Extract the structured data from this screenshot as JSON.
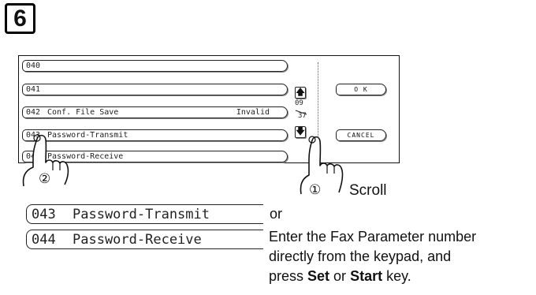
{
  "step": {
    "number": "6"
  },
  "lcd": {
    "rows": [
      {
        "num": "040",
        "name": "",
        "value": ""
      },
      {
        "num": "041",
        "name": "",
        "value": ""
      },
      {
        "num": "042",
        "name": "Conf. File Save",
        "value": "Invalid"
      },
      {
        "num": "043",
        "name": "Password-Transmit",
        "value": ""
      },
      {
        "num": "044",
        "name": "Password-Receive",
        "value": ""
      }
    ],
    "scroll_up_icon": "up-arrow-icon",
    "scroll_down_icon": "down-arrow-icon",
    "scroll_up_glyph": "🡅",
    "scroll_down_glyph": "🡇",
    "page_current": "09",
    "page_total": "37",
    "ok_label": "O K",
    "cancel_label": "CANCEL"
  },
  "callouts": {
    "hand_left_marker": "②",
    "hand_right_marker": "①",
    "scroll_label": "Scroll"
  },
  "display_examples": [
    {
      "num": "043",
      "name": "Password-Transmit"
    },
    {
      "num": "044",
      "name": "Password-Receive"
    }
  ],
  "instruction": {
    "or": "or",
    "line1": "Enter the Fax Parameter number",
    "line2": "directly from the keypad, and",
    "line3_pre": "press ",
    "set": "Set",
    "mid": " or ",
    "start": "Start",
    "post": " key."
  }
}
